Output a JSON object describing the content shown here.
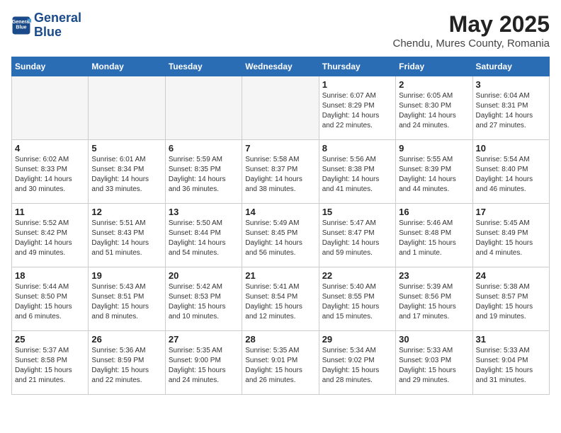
{
  "logo": {
    "line1": "General",
    "line2": "Blue"
  },
  "title": "May 2025",
  "location": "Chendu, Mures County, Romania",
  "weekdays": [
    "Sunday",
    "Monday",
    "Tuesday",
    "Wednesday",
    "Thursday",
    "Friday",
    "Saturday"
  ],
  "weeks": [
    [
      {
        "day": "",
        "info": ""
      },
      {
        "day": "",
        "info": ""
      },
      {
        "day": "",
        "info": ""
      },
      {
        "day": "",
        "info": ""
      },
      {
        "day": "1",
        "info": "Sunrise: 6:07 AM\nSunset: 8:29 PM\nDaylight: 14 hours\nand 22 minutes."
      },
      {
        "day": "2",
        "info": "Sunrise: 6:05 AM\nSunset: 8:30 PM\nDaylight: 14 hours\nand 24 minutes."
      },
      {
        "day": "3",
        "info": "Sunrise: 6:04 AM\nSunset: 8:31 PM\nDaylight: 14 hours\nand 27 minutes."
      }
    ],
    [
      {
        "day": "4",
        "info": "Sunrise: 6:02 AM\nSunset: 8:33 PM\nDaylight: 14 hours\nand 30 minutes."
      },
      {
        "day": "5",
        "info": "Sunrise: 6:01 AM\nSunset: 8:34 PM\nDaylight: 14 hours\nand 33 minutes."
      },
      {
        "day": "6",
        "info": "Sunrise: 5:59 AM\nSunset: 8:35 PM\nDaylight: 14 hours\nand 36 minutes."
      },
      {
        "day": "7",
        "info": "Sunrise: 5:58 AM\nSunset: 8:37 PM\nDaylight: 14 hours\nand 38 minutes."
      },
      {
        "day": "8",
        "info": "Sunrise: 5:56 AM\nSunset: 8:38 PM\nDaylight: 14 hours\nand 41 minutes."
      },
      {
        "day": "9",
        "info": "Sunrise: 5:55 AM\nSunset: 8:39 PM\nDaylight: 14 hours\nand 44 minutes."
      },
      {
        "day": "10",
        "info": "Sunrise: 5:54 AM\nSunset: 8:40 PM\nDaylight: 14 hours\nand 46 minutes."
      }
    ],
    [
      {
        "day": "11",
        "info": "Sunrise: 5:52 AM\nSunset: 8:42 PM\nDaylight: 14 hours\nand 49 minutes."
      },
      {
        "day": "12",
        "info": "Sunrise: 5:51 AM\nSunset: 8:43 PM\nDaylight: 14 hours\nand 51 minutes."
      },
      {
        "day": "13",
        "info": "Sunrise: 5:50 AM\nSunset: 8:44 PM\nDaylight: 14 hours\nand 54 minutes."
      },
      {
        "day": "14",
        "info": "Sunrise: 5:49 AM\nSunset: 8:45 PM\nDaylight: 14 hours\nand 56 minutes."
      },
      {
        "day": "15",
        "info": "Sunrise: 5:47 AM\nSunset: 8:47 PM\nDaylight: 14 hours\nand 59 minutes."
      },
      {
        "day": "16",
        "info": "Sunrise: 5:46 AM\nSunset: 8:48 PM\nDaylight: 15 hours\nand 1 minute."
      },
      {
        "day": "17",
        "info": "Sunrise: 5:45 AM\nSunset: 8:49 PM\nDaylight: 15 hours\nand 4 minutes."
      }
    ],
    [
      {
        "day": "18",
        "info": "Sunrise: 5:44 AM\nSunset: 8:50 PM\nDaylight: 15 hours\nand 6 minutes."
      },
      {
        "day": "19",
        "info": "Sunrise: 5:43 AM\nSunset: 8:51 PM\nDaylight: 15 hours\nand 8 minutes."
      },
      {
        "day": "20",
        "info": "Sunrise: 5:42 AM\nSunset: 8:53 PM\nDaylight: 15 hours\nand 10 minutes."
      },
      {
        "day": "21",
        "info": "Sunrise: 5:41 AM\nSunset: 8:54 PM\nDaylight: 15 hours\nand 12 minutes."
      },
      {
        "day": "22",
        "info": "Sunrise: 5:40 AM\nSunset: 8:55 PM\nDaylight: 15 hours\nand 15 minutes."
      },
      {
        "day": "23",
        "info": "Sunrise: 5:39 AM\nSunset: 8:56 PM\nDaylight: 15 hours\nand 17 minutes."
      },
      {
        "day": "24",
        "info": "Sunrise: 5:38 AM\nSunset: 8:57 PM\nDaylight: 15 hours\nand 19 minutes."
      }
    ],
    [
      {
        "day": "25",
        "info": "Sunrise: 5:37 AM\nSunset: 8:58 PM\nDaylight: 15 hours\nand 21 minutes."
      },
      {
        "day": "26",
        "info": "Sunrise: 5:36 AM\nSunset: 8:59 PM\nDaylight: 15 hours\nand 22 minutes."
      },
      {
        "day": "27",
        "info": "Sunrise: 5:35 AM\nSunset: 9:00 PM\nDaylight: 15 hours\nand 24 minutes."
      },
      {
        "day": "28",
        "info": "Sunrise: 5:35 AM\nSunset: 9:01 PM\nDaylight: 15 hours\nand 26 minutes."
      },
      {
        "day": "29",
        "info": "Sunrise: 5:34 AM\nSunset: 9:02 PM\nDaylight: 15 hours\nand 28 minutes."
      },
      {
        "day": "30",
        "info": "Sunrise: 5:33 AM\nSunset: 9:03 PM\nDaylight: 15 hours\nand 29 minutes."
      },
      {
        "day": "31",
        "info": "Sunrise: 5:33 AM\nSunset: 9:04 PM\nDaylight: 15 hours\nand 31 minutes."
      }
    ]
  ]
}
